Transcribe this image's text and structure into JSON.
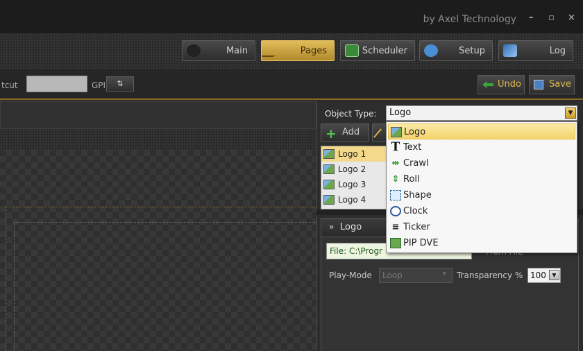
{
  "window": {
    "brand": "by Axel Technology",
    "minimize_glyph": "–",
    "maximize_glyph": "▫",
    "close_glyph": "×"
  },
  "nav": {
    "items": [
      {
        "label": "Main",
        "icon": "main-icon"
      },
      {
        "label": "Pages",
        "icon": "pages-icon",
        "active": true
      },
      {
        "label": "Scheduler",
        "icon": "scheduler-icon"
      },
      {
        "label": "Setup",
        "icon": "setup-icon"
      },
      {
        "label": "Log",
        "icon": "log-icon"
      }
    ]
  },
  "toolbar": {
    "shortcut_label": "tcut",
    "shortcut_value": "",
    "gpi_label": "GPI",
    "gpi_glyph": "⇅",
    "undo_label": "Undo",
    "save_label": "Save"
  },
  "object_type": {
    "label": "Object Type:",
    "selected": "Logo",
    "arrow_glyph": "▼",
    "options": [
      {
        "label": "Logo",
        "icon": "logo-icon"
      },
      {
        "label": "Text",
        "icon": "text-icon"
      },
      {
        "label": "Crawl",
        "icon": "crawl-icon"
      },
      {
        "label": "Roll",
        "icon": "roll-icon"
      },
      {
        "label": "Shape",
        "icon": "shape-icon"
      },
      {
        "label": "Clock",
        "icon": "clock-icon"
      },
      {
        "label": "Ticker",
        "icon": "ticker-icon"
      },
      {
        "label": "PIP DVE",
        "icon": "pip-dve-icon"
      }
    ]
  },
  "object_actions": {
    "add_label": "Add"
  },
  "object_list": [
    "Logo 1",
    "Logo 2",
    "Logo 3",
    "Logo 4"
  ],
  "properties": {
    "chevron": "»",
    "title": "Logo",
    "file_value": "File: C:\\Progr",
    "from_file_label": "From File",
    "play_mode_label": "Play-Mode",
    "play_mode_value": "Loop",
    "play_mode_arrow": "▾",
    "transparency_label": "Transparency %",
    "transparency_value": "100",
    "transparency_arrow": "▼"
  },
  "colors": {
    "accent": "#d9b04a",
    "background": "#2b2b2b",
    "selection": "#f5d98a"
  }
}
